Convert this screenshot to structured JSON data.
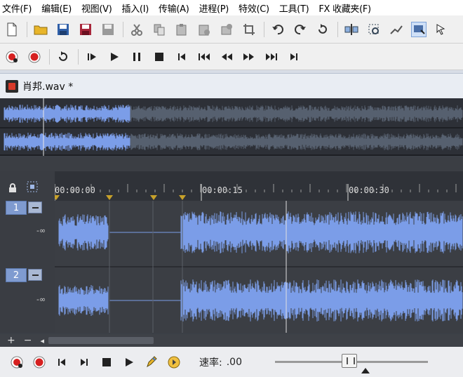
{
  "menu": [
    "文件(F)",
    "编辑(E)",
    "视图(V)",
    "插入(I)",
    "传输(A)",
    "进程(P)",
    "特效(C)",
    "工具(T)",
    "FX 收藏夹(F)"
  ],
  "toolbar_icons": [
    "new-file-icon",
    "open-folder-icon",
    "save-icon",
    "save-as-icon",
    "save-all-icon",
    "cut-icon",
    "copy-icon",
    "paste-icon",
    "paste-new-icon",
    "mix-icon",
    "crop-icon",
    "undo-icon",
    "redo-icon",
    "repeat-icon",
    "split-icon",
    "selection-icon",
    "envelope-icon",
    "draw-tool-icon",
    "cursor-icon"
  ],
  "transport_top_icons": [
    "record-arm-icon",
    "record-icon",
    "loop-icon",
    "play-from-start-icon",
    "play-icon",
    "pause-icon",
    "stop-icon",
    "go-start-icon",
    "rewind-icon",
    "rewind-fast-icon",
    "forward-icon",
    "forward-fast-icon",
    "go-end-icon"
  ],
  "file": {
    "name": "肖邦.wav *"
  },
  "ruler": {
    "labels": [
      "00:00:00",
      "00:00:15",
      "00:00:30"
    ]
  },
  "tracks": [
    {
      "number": "1",
      "level": "-∞"
    },
    {
      "number": "2",
      "level": "-∞"
    }
  ],
  "bottom_nav": {
    "add": "+",
    "remove": "−",
    "left": "◂"
  },
  "transport": {
    "rate_label": "速率:",
    "rate_value": ".00",
    "rate_slider_fraction": 0.5
  },
  "colors": {
    "waveform": "#7b9de8",
    "waveform_dim": "#56606f",
    "background": "#3b3e44",
    "marker": "#c7a12a"
  }
}
